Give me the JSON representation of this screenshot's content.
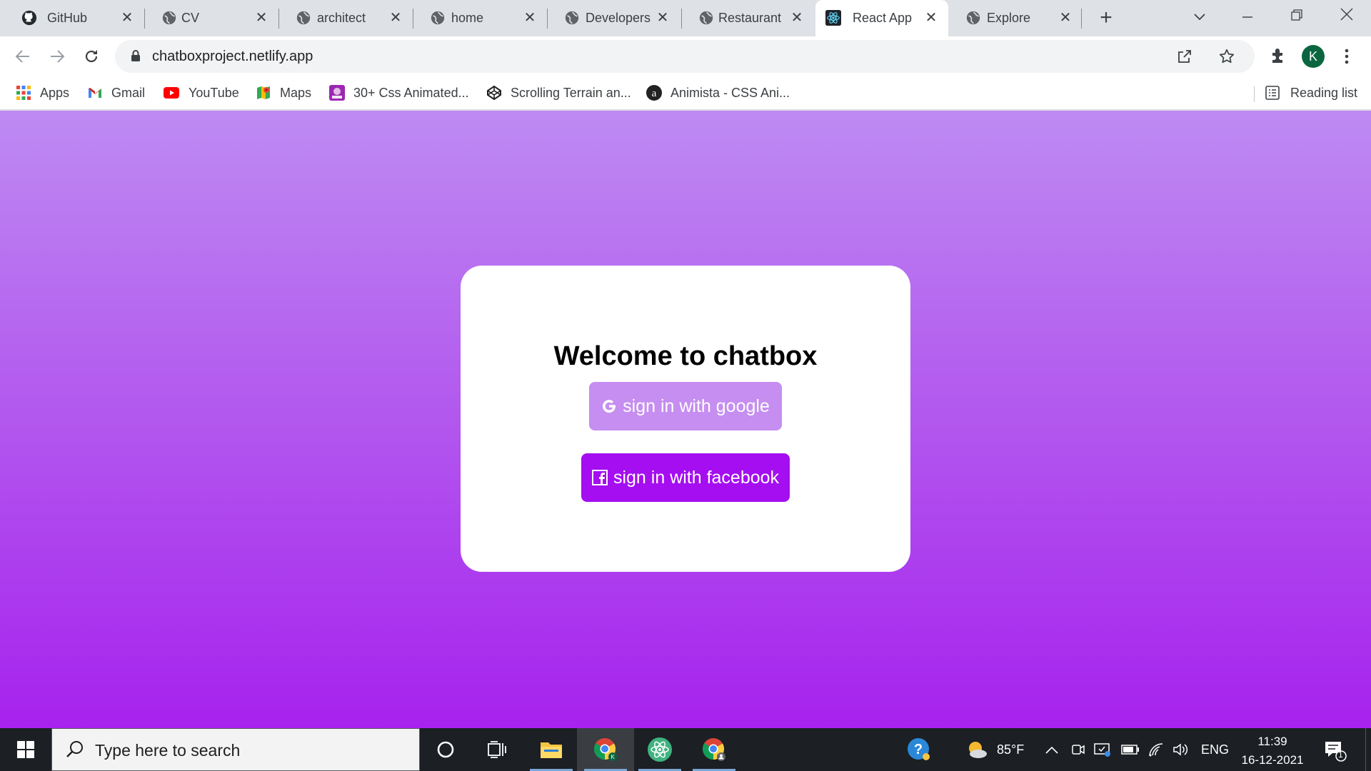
{
  "browser": {
    "tabs": [
      {
        "title": "GitHub",
        "icon": "github-icon"
      },
      {
        "title": "CV",
        "icon": "globe-icon"
      },
      {
        "title": "architect",
        "icon": "globe-icon"
      },
      {
        "title": "home",
        "icon": "globe-icon"
      },
      {
        "title": "Developers",
        "icon": "globe-icon"
      },
      {
        "title": "Restaurant",
        "icon": "globe-icon"
      },
      {
        "title": "React App",
        "icon": "react-icon",
        "active": true
      },
      {
        "title": "Explore",
        "icon": "globe-icon"
      }
    ],
    "url": "chatboxproject.netlify.app",
    "profile_initial": "K",
    "bookmarks": [
      {
        "label": "Apps",
        "icon": "apps-grid-icon"
      },
      {
        "label": "Gmail",
        "icon": "gmail-icon"
      },
      {
        "label": "YouTube",
        "icon": "youtube-icon"
      },
      {
        "label": "Maps",
        "icon": "maps-icon"
      },
      {
        "label": "30+ Css Animated...",
        "icon": "css-animated-icon"
      },
      {
        "label": "Scrolling Terrain an...",
        "icon": "codepen-icon"
      },
      {
        "label": "Animista - CSS Ani...",
        "icon": "animista-icon"
      }
    ],
    "reading_list": "Reading list"
  },
  "page": {
    "title": "Welcome to chatbox",
    "google_button": "sign in with google",
    "facebook_button": "sign in with facebook",
    "colors": {
      "gradient_top": "#be8af2",
      "gradient_bottom": "#a722ee",
      "google_button": "#c58ef0",
      "facebook_button": "#a40ef0"
    }
  },
  "taskbar": {
    "search_placeholder": "Type here to search",
    "weather": "85°F",
    "language": "ENG",
    "time": "11:39",
    "date": "16-12-2021",
    "notification_count": "1"
  }
}
